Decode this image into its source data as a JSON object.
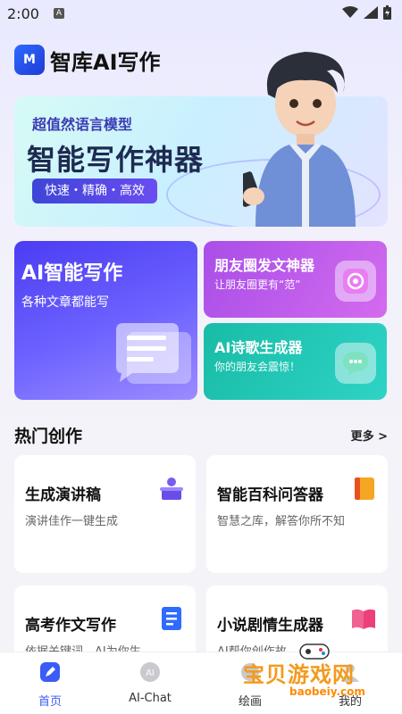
{
  "status": {
    "time": "2:00",
    "a_label": "A"
  },
  "header": {
    "logo_text": "M",
    "title": "智库AI写作"
  },
  "hero": {
    "subtitle": "超值然语言模型",
    "title": "智能写作神器",
    "pill": "快速・精确・高效"
  },
  "features": {
    "big": {
      "title": "AI智能写作",
      "desc": "各种文章都能写"
    },
    "moments": {
      "title": "朋友圈发文神器",
      "desc": "让朋友圈更有“范”"
    },
    "poem": {
      "title": "AI诗歌生成器",
      "desc": "你的朋友会震惊！"
    }
  },
  "section": {
    "title": "热门创作",
    "more": "更多 >"
  },
  "grid": [
    {
      "title": "生成演讲稿",
      "desc": "演讲佳作一键生成",
      "icon": "podium-icon",
      "color": "#7b5cf0"
    },
    {
      "title": "智能百科问答器",
      "desc": "智慧之库，解答你所不知",
      "icon": "book-icon",
      "color": "#f5a623"
    },
    {
      "title": "高考作文写作",
      "desc": "依据关键词，AI为你生",
      "icon": "document-icon",
      "color": "#2f6bff"
    },
    {
      "title": "小说剧情生成器",
      "desc": "AI帮你创作故",
      "icon": "open-book-icon",
      "color": "#f06292"
    }
  ],
  "tabs": [
    {
      "label": "首页",
      "active": true
    },
    {
      "label": "AI-Chat",
      "active": false
    },
    {
      "label": "绘画",
      "active": false
    },
    {
      "label": "我的",
      "active": false
    }
  ],
  "watermark": {
    "title": "宝贝游戏网",
    "url": "baobeiy.com"
  },
  "colors": {
    "accent": "#3b5cf6",
    "purple_card": "#5a4cf5",
    "pink_card": "#c35ded",
    "teal_card": "#22c7b5"
  }
}
